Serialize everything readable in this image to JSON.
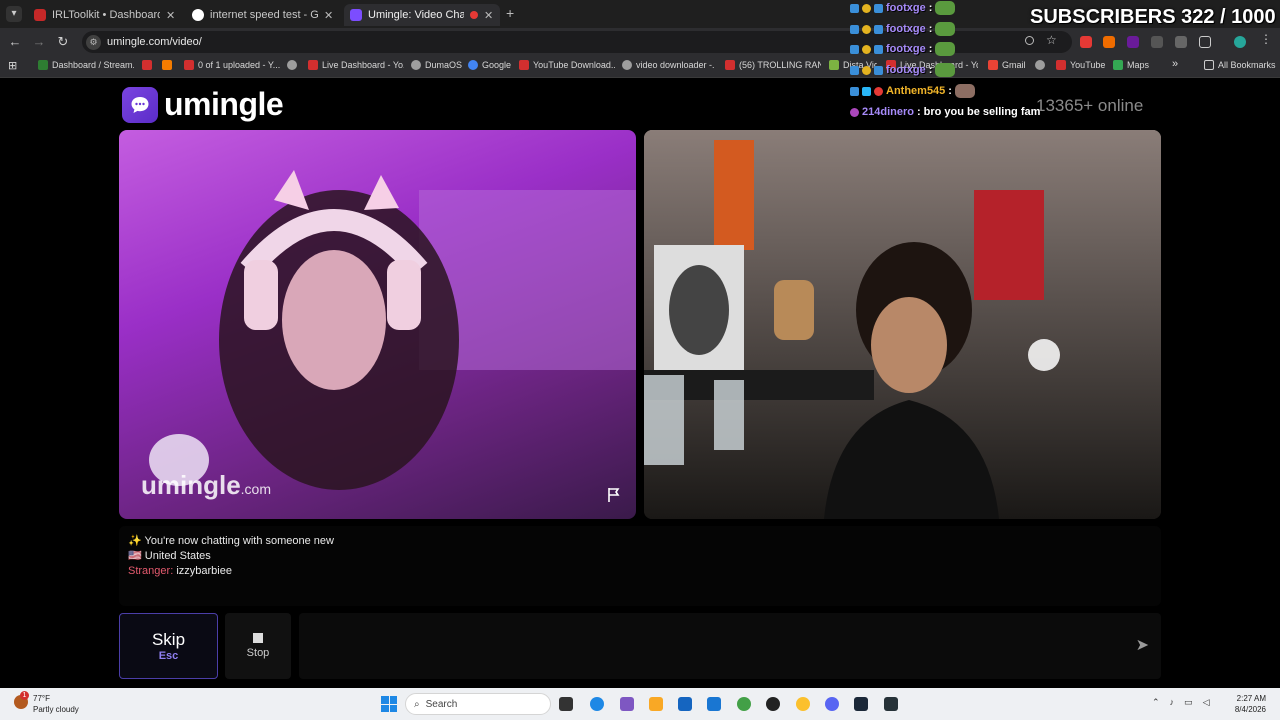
{
  "browser": {
    "tabs": [
      {
        "label": "IRLToolkit • Dashboard",
        "color": "#c62828",
        "active": false
      },
      {
        "label": "internet speed test - Google Se",
        "color": "#ffffff",
        "active": false
      },
      {
        "label": "Umingle: Video Chat with S",
        "color": "#7c4dff",
        "active": true
      }
    ],
    "url": "umingle.com/video/",
    "bookmarks": [
      {
        "label": "Dashboard / Stream...",
        "color": "#2e7d32"
      },
      {
        "label": "",
        "color": "#d32f2f"
      },
      {
        "label": "",
        "color": "#f57c00"
      },
      {
        "label": "0 of 1 uploaded - Y...",
        "color": "#d32f2f"
      },
      {
        "label": "",
        "color": "#9e9e9e"
      },
      {
        "label": "Live Dashboard - Yo...",
        "color": "#d32f2f"
      },
      {
        "label": "DumaOS",
        "color": "#9e9e9e"
      },
      {
        "label": "Google",
        "color": "#4285f4"
      },
      {
        "label": "YouTube Download...",
        "color": "#d32f2f"
      },
      {
        "label": "video downloader -...",
        "color": "#9e9e9e"
      },
      {
        "label": "(56) TROLLING RAN...",
        "color": "#d32f2f"
      },
      {
        "label": "Dista Vid...",
        "color": "#7cb342"
      },
      {
        "label": "Live Dashboard - Yo...",
        "color": "#d32f2f"
      },
      {
        "label": "Gmail",
        "color": "#ea4335"
      },
      {
        "label": "",
        "color": "#9e9e9e"
      },
      {
        "label": "YouTube",
        "color": "#d32f2f"
      },
      {
        "label": "Maps",
        "color": "#34a853"
      }
    ],
    "bookmarks_more": "»",
    "all_bookmarks": "All Bookmarks"
  },
  "site": {
    "logo_text": "umingle",
    "online_count": "13365+ online"
  },
  "video": {
    "watermark": "umingle",
    "watermark_suffix": ".com"
  },
  "chat_log": {
    "system_message": "✨ You're now chatting with someone new",
    "country": "🇺🇸 United States",
    "stranger_label": "Stranger:",
    "stranger_name": "izzybarbiee"
  },
  "controls": {
    "skip_label": "Skip",
    "skip_key": "Esc",
    "stop_label": "Stop",
    "message_placeholder": ""
  },
  "stream_overlay": {
    "subscribers_label": "SUBSCRIBERS 322 / 1000",
    "chat": [
      {
        "user": "footxge",
        "msg": "",
        "emote": true
      },
      {
        "user": "footxge",
        "msg": "",
        "emote": true
      },
      {
        "user": "footxge",
        "msg": "",
        "emote": true
      },
      {
        "user": "footxge",
        "msg": "",
        "emote": true
      },
      {
        "user": "Anthem545",
        "msg": "",
        "emote": true
      },
      {
        "user": "214dinero",
        "msg": "bro you be selling fam",
        "emote": false
      }
    ]
  },
  "taskbar": {
    "temperature": "77°F",
    "weather": "Partly cloudy",
    "weather_badge": "1",
    "search_label": "Search",
    "time": "2:27 AM",
    "date": "8/4/2026"
  },
  "colors": {
    "accent": "#7c4dff",
    "stranger": "#e45a6e"
  }
}
